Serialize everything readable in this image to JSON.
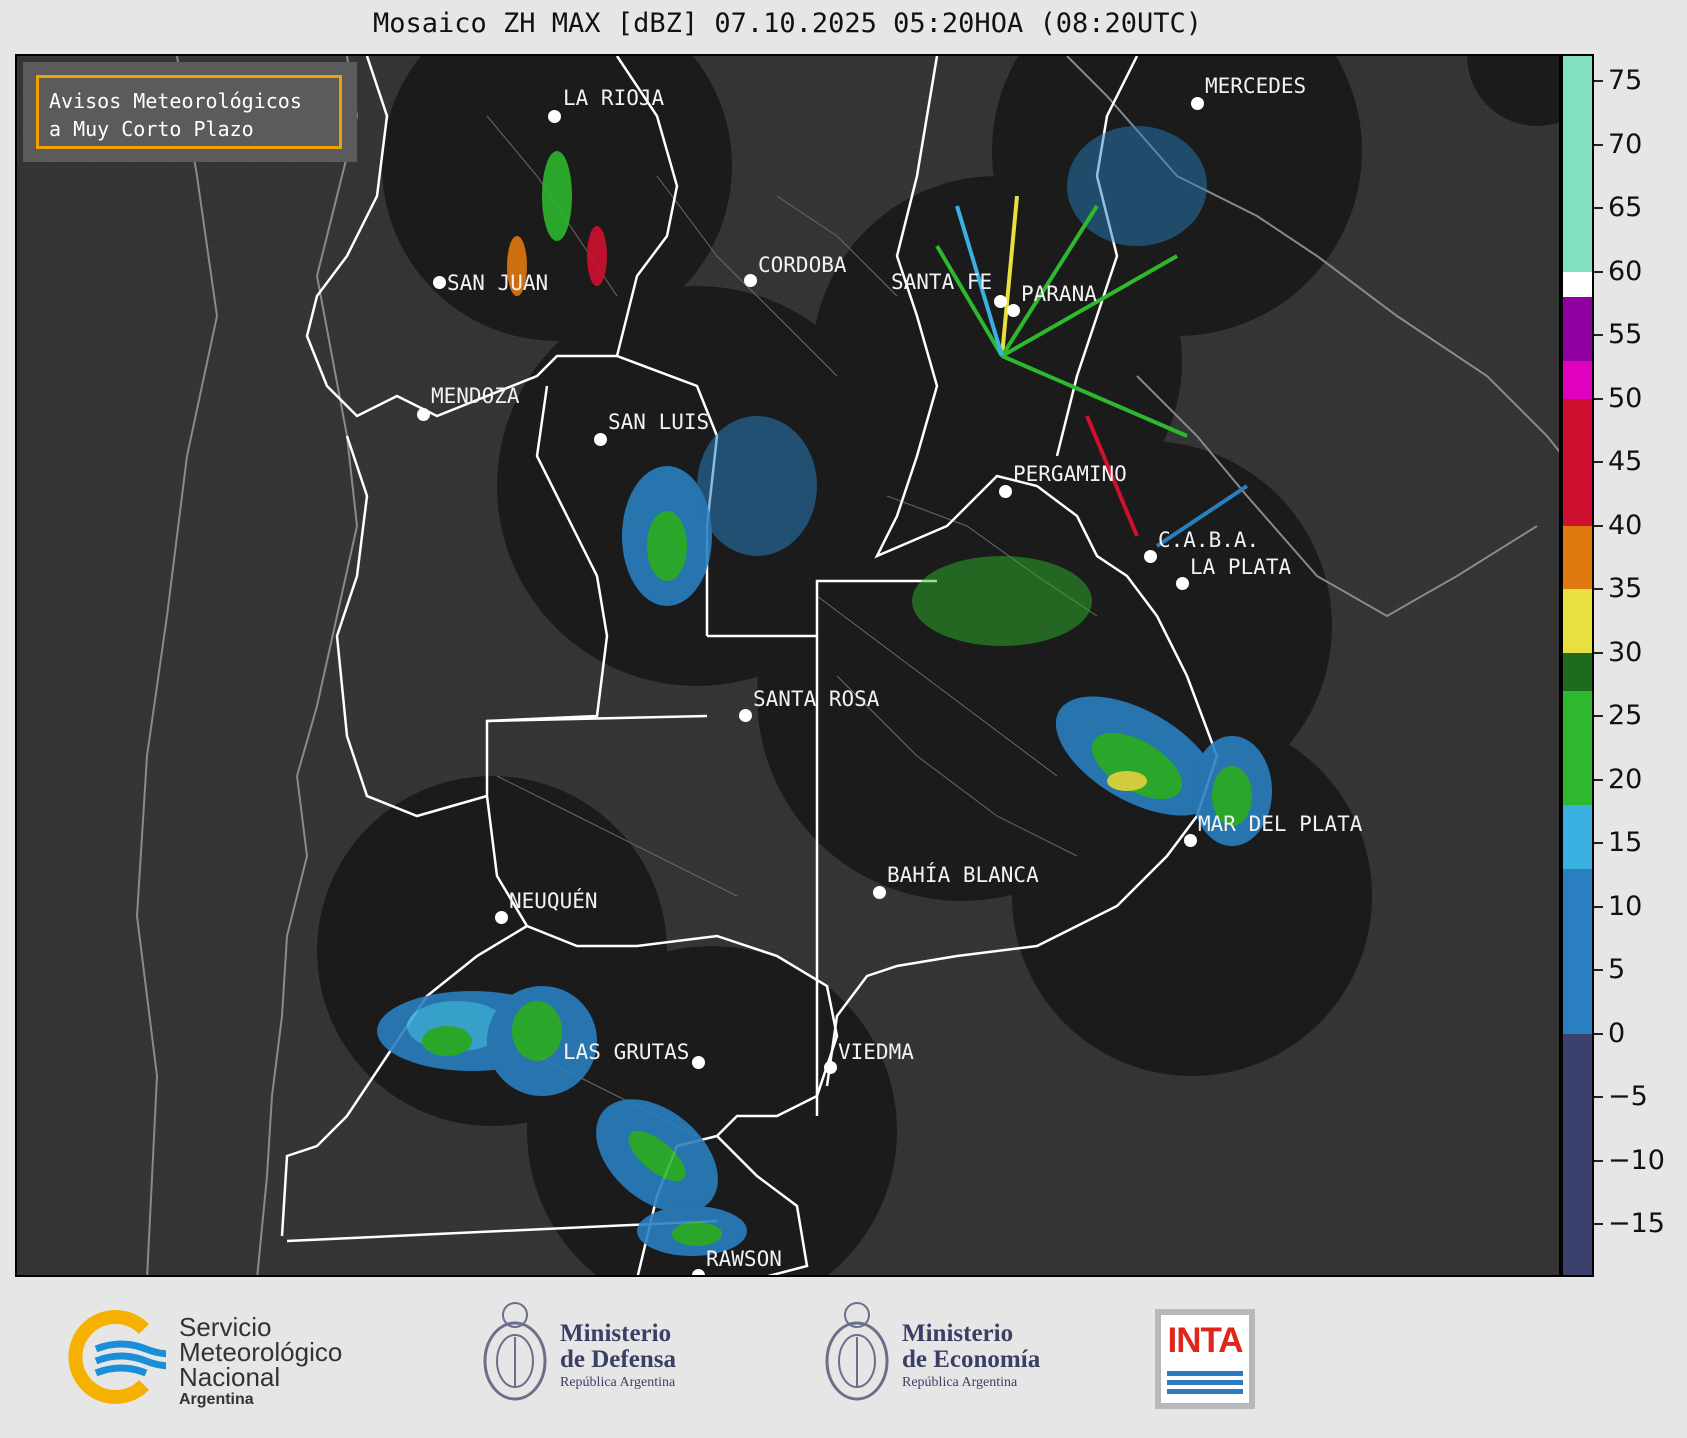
{
  "title": "Mosaico ZH MAX [dBZ] 07.10.2025 05:20HOA (08:20UTC)",
  "notice": {
    "line1": "Avisos Meteorológicos",
    "line2": "a Muy Corto Plazo"
  },
  "cities": [
    {
      "name": "LA RIOJA"
    },
    {
      "name": "SAN JUAN"
    },
    {
      "name": "CORDOBA"
    },
    {
      "name": "MENDOZA"
    },
    {
      "name": "SAN LUIS"
    },
    {
      "name": "SANTA FE"
    },
    {
      "name": "PARANA"
    },
    {
      "name": "MERCEDES"
    },
    {
      "name": "PERGAMINO"
    },
    {
      "name": "C.A.B.A."
    },
    {
      "name": "LA PLATA"
    },
    {
      "name": "SANTA ROSA"
    },
    {
      "name": "MAR DEL PLATA"
    },
    {
      "name": "BAHÍA BLANCA"
    },
    {
      "name": "NEUQUÉN"
    },
    {
      "name": "LAS GRUTAS"
    },
    {
      "name": "VIEDMA"
    },
    {
      "name": "RAWSON"
    }
  ],
  "colorbar": {
    "unit": "dBZ",
    "ticks": [
      "75",
      "70",
      "65",
      "60",
      "55",
      "50",
      "45",
      "40",
      "35",
      "30",
      "25",
      "20",
      "15",
      "10",
      "5",
      "0",
      "−5",
      "−10",
      "−15"
    ],
    "range": [
      -19,
      77
    ],
    "colors": {
      "low": "#3a3f6b",
      "mid_blue": "#2a7fc0",
      "light_blue": "#3ab0e0",
      "green": "#2db82d",
      "dark_green": "#1e6b1e",
      "yellow": "#e8e040",
      "orange": "#e07a10",
      "red": "#d01030",
      "magenta": "#e000c0",
      "purple": "#9000a0",
      "white": "#ffffff",
      "aqua": "#80e0c0"
    }
  },
  "logos": {
    "smn": {
      "line1": "Servicio",
      "line2": "Meteorológico",
      "line3": "Nacional",
      "line4": "Argentina"
    },
    "defensa": {
      "line1": "Ministerio",
      "line2": "de Defensa",
      "line3": "República Argentina"
    },
    "economia": {
      "line1": "Ministerio",
      "line2": "de Economía",
      "line3": "República Argentina"
    },
    "inta": {
      "text": "INTA"
    }
  }
}
